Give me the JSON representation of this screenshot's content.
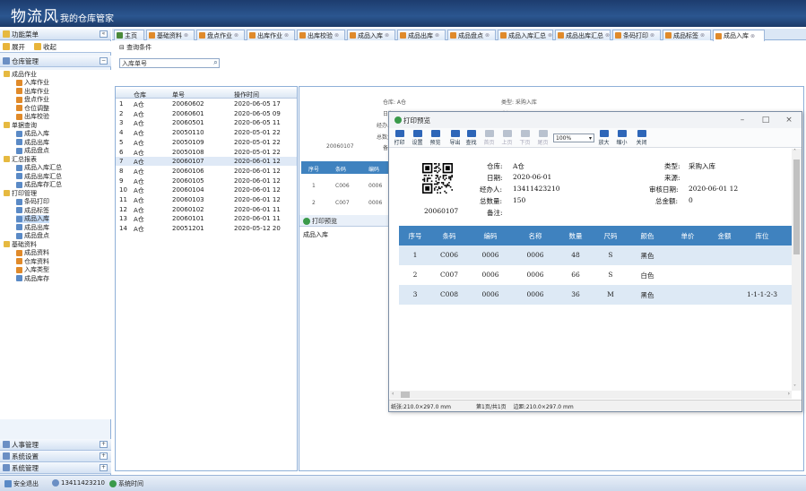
{
  "app": {
    "title": "物流风",
    "subtitle": "我的仓库管家"
  },
  "sidebar": {
    "header": "功能菜单",
    "quick": [
      "展开",
      "收起"
    ],
    "section": "仓库管理",
    "tree": [
      {
        "label": "成品作业",
        "level": 0,
        "type": "folder"
      },
      {
        "label": "入库作业",
        "level": 1,
        "type": "pen"
      },
      {
        "label": "出库作业",
        "level": 1,
        "type": "pen"
      },
      {
        "label": "盘点作业",
        "level": 1,
        "type": "pen"
      },
      {
        "label": "仓位调整",
        "level": 1,
        "type": "pen"
      },
      {
        "label": "出库校验",
        "level": 1,
        "type": "pen"
      },
      {
        "label": "单据查询",
        "level": 0,
        "type": "folder"
      },
      {
        "label": "成品入库",
        "level": 1,
        "type": "doc"
      },
      {
        "label": "成品出库",
        "level": 1,
        "type": "doc"
      },
      {
        "label": "成品盘点",
        "level": 1,
        "type": "doc"
      },
      {
        "label": "汇总报表",
        "level": 0,
        "type": "folder"
      },
      {
        "label": "成品入库汇总",
        "level": 1,
        "type": "doc"
      },
      {
        "label": "成品出库汇总",
        "level": 1,
        "type": "doc"
      },
      {
        "label": "成品库存汇总",
        "level": 1,
        "type": "doc"
      },
      {
        "label": "打印管理",
        "level": 0,
        "type": "folder"
      },
      {
        "label": "条码打印",
        "level": 1,
        "type": "doc"
      },
      {
        "label": "成品标签",
        "level": 1,
        "type": "doc"
      },
      {
        "label": "成品入库",
        "level": 1,
        "type": "doc",
        "selected": true
      },
      {
        "label": "成品出库",
        "level": 1,
        "type": "doc"
      },
      {
        "label": "成品盘点",
        "level": 1,
        "type": "doc"
      },
      {
        "label": "基础资料",
        "level": 0,
        "type": "folder"
      },
      {
        "label": "成品资料",
        "level": 1,
        "type": "pen"
      },
      {
        "label": "仓库资料",
        "level": 1,
        "type": "pen"
      },
      {
        "label": "入库类型",
        "level": 1,
        "type": "pen"
      },
      {
        "label": "成品库存",
        "level": 1,
        "type": "doc"
      }
    ],
    "bottom": [
      {
        "label": "人事管理"
      },
      {
        "label": "系统设置"
      },
      {
        "label": "系统管理"
      }
    ]
  },
  "tabs": [
    {
      "label": "主页",
      "closable": false
    },
    {
      "label": "基础资料"
    },
    {
      "label": "盘点作业"
    },
    {
      "label": "出库作业"
    },
    {
      "label": "出库校验"
    },
    {
      "label": "成品入库"
    },
    {
      "label": "成品出库"
    },
    {
      "label": "成品盘点"
    },
    {
      "label": "成品入库汇总"
    },
    {
      "label": "成品出库汇总"
    },
    {
      "label": "条码打印"
    },
    {
      "label": "成品标签"
    },
    {
      "label": "成品入库",
      "active": true
    }
  ],
  "filter": {
    "title": "查询条件",
    "placeholder": "入库单号",
    "search_icon": "search-icon"
  },
  "list": {
    "columns": [
      "仓库",
      "单号",
      "操作时间"
    ],
    "rows": [
      {
        "n": "1",
        "wh": "A仓",
        "no": "20060602",
        "time": "2020-06-05 17"
      },
      {
        "n": "2",
        "wh": "A仓",
        "no": "20060601",
        "time": "2020-06-05 09"
      },
      {
        "n": "3",
        "wh": "A仓",
        "no": "20060501",
        "time": "2020-06-05 11"
      },
      {
        "n": "4",
        "wh": "A仓",
        "no": "20050110",
        "time": "2020-05-01 22"
      },
      {
        "n": "5",
        "wh": "A仓",
        "no": "20050109",
        "time": "2020-05-01 22"
      },
      {
        "n": "6",
        "wh": "A仓",
        "no": "20050108",
        "time": "2020-05-01 22"
      },
      {
        "n": "7",
        "wh": "A仓",
        "no": "20060107",
        "time": "2020-06-01 12",
        "selected": true
      },
      {
        "n": "8",
        "wh": "A仓",
        "no": "20060106",
        "time": "2020-06-01 12"
      },
      {
        "n": "9",
        "wh": "A仓",
        "no": "20060105",
        "time": "2020-06-01 12"
      },
      {
        "n": "10",
        "wh": "A仓",
        "no": "20060104",
        "time": "2020-06-01 12"
      },
      {
        "n": "11",
        "wh": "A仓",
        "no": "20060103",
        "time": "2020-06-01 12"
      },
      {
        "n": "12",
        "wh": "A仓",
        "no": "20060102",
        "time": "2020-06-01 11"
      },
      {
        "n": "13",
        "wh": "A仓",
        "no": "20060101",
        "time": "2020-06-01 11"
      },
      {
        "n": "14",
        "wh": "A仓",
        "no": "20051201",
        "time": "2020-05-12 20"
      }
    ]
  },
  "mid": {
    "action": "打印预览",
    "section": "成品入库",
    "col1": "序号",
    "col2": "条码",
    "col3": "编码"
  },
  "dialog": {
    "title": "打印预览",
    "tools": [
      "打印",
      "设置",
      "预览",
      "导出",
      "查找",
      "首页",
      "上页",
      "下页",
      "尾页",
      "放大",
      "缩小",
      "关闭"
    ],
    "zoom": "100%",
    "barcode_no": "20060107",
    "fields": {
      "warehouse_label": "仓库:",
      "warehouse": "A仓",
      "date_label": "日期:",
      "date": "2020-06-01",
      "operator_label": "经办人:",
      "operator": "13411423210",
      "total_label": "总数量:",
      "total": "150",
      "remark_label": "备注:",
      "remark": "",
      "type_label": "类型:",
      "type": "采购入库",
      "source_label": "来源:",
      "source": "",
      "audit_label": "审核日期:",
      "audit": "2020-06-01 12",
      "amount_label": "总金额:",
      "amount": "0"
    },
    "columns": [
      "序号",
      "条码",
      "编码",
      "名称",
      "数量",
      "尺码",
      "颜色",
      "单价",
      "金额",
      "库位"
    ],
    "rows": [
      {
        "n": "1",
        "barcode": "C006",
        "code": "0006",
        "name": "0006",
        "qty": "48",
        "size": "S",
        "color": "黑色",
        "price": "",
        "amount": "",
        "loc": ""
      },
      {
        "n": "2",
        "barcode": "C007",
        "code": "0006",
        "name": "0006",
        "qty": "66",
        "size": "S",
        "color": "白色",
        "price": "",
        "amount": "",
        "loc": ""
      },
      {
        "n": "3",
        "barcode": "C008",
        "code": "0006",
        "name": "0006",
        "qty": "36",
        "size": "M",
        "color": "黑色",
        "price": "",
        "amount": "",
        "loc": "1-1-1-2-3"
      }
    ],
    "status": [
      "纸张:210.0×297.0 mm",
      "第1页/共1页",
      "边距:210.0×297.0 mm"
    ]
  },
  "statusbar": {
    "items": [
      "安全退出",
      "13411423210",
      "系统时间"
    ]
  },
  "colors": {
    "header": "#2b5690",
    "accent": "#3f82bf",
    "selected": "#c5dbf5"
  }
}
